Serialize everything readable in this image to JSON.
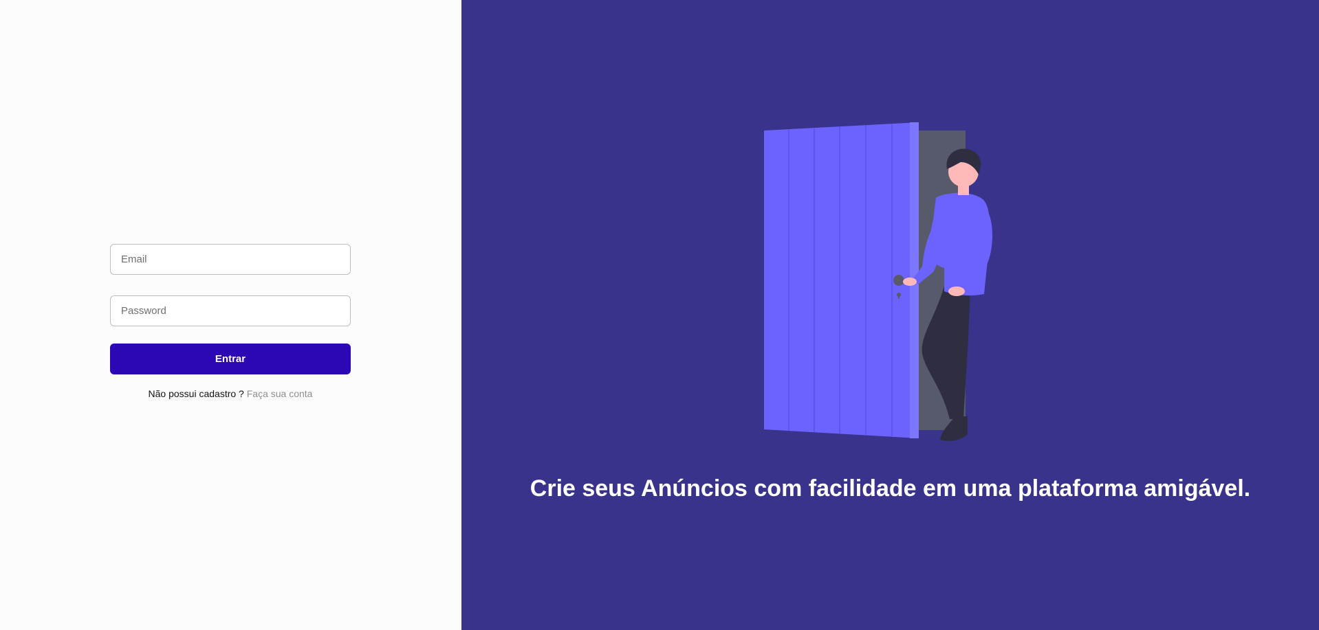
{
  "login": {
    "email_placeholder": "Email",
    "password_placeholder": "Password",
    "submit_label": "Entrar",
    "signup_prompt": "Não possui cadastro ?",
    "signup_link": "Faça sua conta"
  },
  "hero": {
    "tagline": "Crie seus Anúncios com facilidade em uma plataforma amigável."
  },
  "colors": {
    "left_background": "#fdfcfc",
    "right_background": "#39338b",
    "button": "#2c07b4",
    "door": "#6c63ff",
    "link": "#8e8e8e"
  }
}
